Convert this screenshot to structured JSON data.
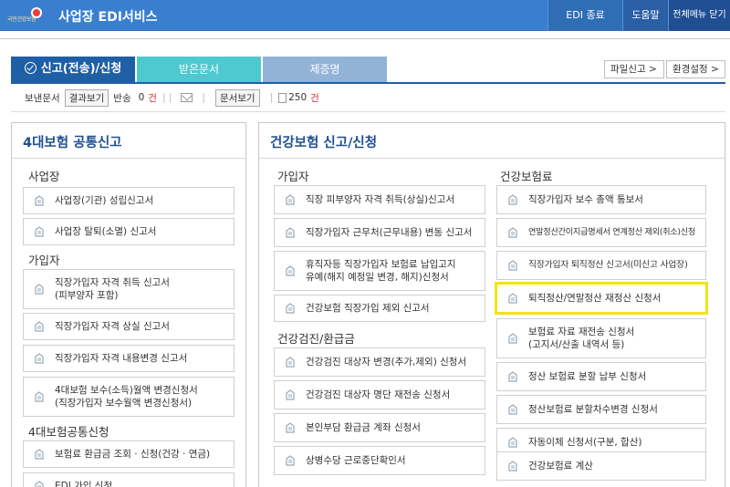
{
  "topbar": {
    "logo_text": "국민건강보험",
    "app_title": "사업장 EDI서비스",
    "edi_exit": "EDI 종료",
    "help": "도움말",
    "close_all": "전체메뉴 닫기"
  },
  "tabs": {
    "report": "신고(전송)/신청",
    "received": "받은문서",
    "certificate": "제증명"
  },
  "buttons": {
    "file_report": "파일신고 >",
    "env_settings": "환경설정 >"
  },
  "status": {
    "sent_label": "보낸문서",
    "result_view": "결과보기",
    "return_label": "반송",
    "return_count": "0",
    "return_unit": "건",
    "doc_view": "문서보기",
    "doc_count": "250",
    "doc_unit": "건"
  },
  "left_panel": {
    "title": "4대보험 공통신고",
    "sections": [
      "사업장",
      "가입자",
      "4대보험공통신청"
    ],
    "items": [
      "사업장(기관) 성립신고서",
      "사업장 탈퇴(소멸) 신고서",
      "직장가입자 자격 취득 신고서\n(피부양자 포함)",
      "직장가입자 자격 상실 신고서",
      "직장가입자 자격 내용변경 신고서",
      "4대보험 보수(소득)월액 변경신청서\n(직장가입자 보수월액 변경신청서)",
      "보험료 환급금 조회 · 신청(건강 · 연금)",
      "EDI 가입 신청"
    ]
  },
  "right_panel": {
    "title": "건강보험 신고/신청",
    "sections": [
      "가입자",
      "건강검진/환급금",
      "건강보험료"
    ],
    "col1_items": [
      "직장 피부양자 자격 취득(상실)신고서",
      "직장가입자 근무처(근무내용) 변동 신고서",
      "휴직자등 직장가입자 보험료 납입고지\n유예(해지 예정일 변경, 해지)신청서",
      "건강보험 직장가입 제외 신고서",
      "건강검진 대상자 변경(추가,제외) 신청서",
      "건강검진 대상자 명단 재전송 신청서",
      "본인부담 환급금 계좌 신청서",
      "상병수당 근로중단확인서"
    ],
    "col2_items": [
      "직장가입자 보수 총액 통보서",
      "연말정산간이지급명세서 연계정산 제외(취소)신청",
      "직장가입자 퇴직정산 신고서(미신고 사업장)",
      "퇴직정산/연말정산 재정산 신청서",
      "보험료 자료 재전송 신청서\n(고지서/산출 내역서 등)",
      "정산 보험료 분할 납부 신청서",
      "정산보험료 분할차수변경 신청서",
      "자동이체 신청서(구분, 합산)",
      "건강보험료 계산"
    ]
  },
  "highlight_color": "#f2e21a",
  "accent_color": "#1f5fa6"
}
